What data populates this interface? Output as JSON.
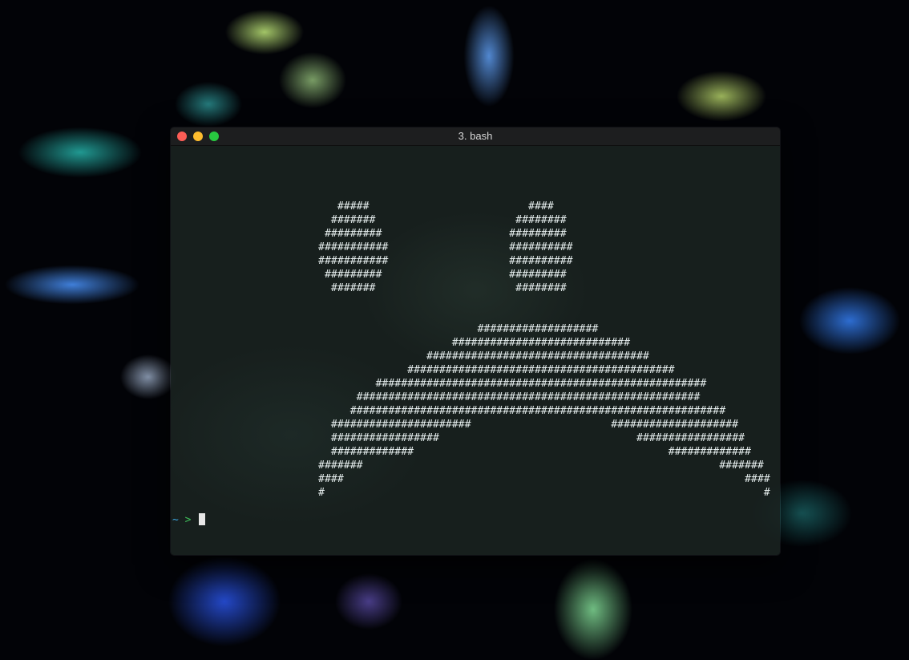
{
  "window": {
    "title": "3. bash"
  },
  "terminal": {
    "ascii_art": [
      "   #####                         ####",
      "  #######                      ########",
      " #########                    #########",
      "###########                   ##########",
      "###########                   ##########",
      " #########                    #########",
      "  #######                      ########",
      "",
      "",
      "                         ###################",
      "                     ############################",
      "                 ###################################",
      "              ##########################################",
      "         ####################################################",
      "      ######################################################",
      "     ###########################################################",
      "  ######################                      ####################",
      "  #################                               #################",
      "  #############                                        #############",
      "#######                                                        #######",
      "####                                                               ####",
      "#                                                                     #"
    ],
    "prompt": {
      "tilde": "~",
      "arrow": ">"
    }
  },
  "colors": {
    "close": "#fc5d56",
    "minimize": "#fdbc2e",
    "zoom": "#28c840",
    "prompt_tilde": "#3da5e0",
    "prompt_arrow": "#3fbf5a"
  }
}
